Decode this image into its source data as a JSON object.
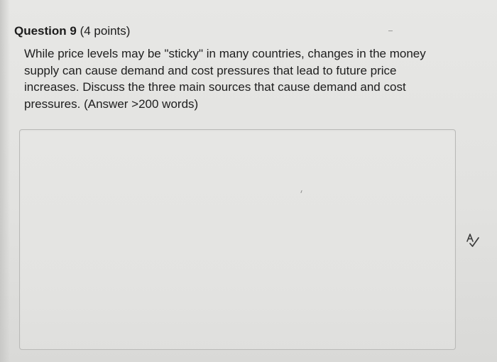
{
  "question": {
    "title": "Question 9",
    "points": " (4 points)",
    "prompt_lines": [
      "While price levels may be \"sticky\" in many countries, changes in the money",
      "supply can cause demand and cost pressures that lead to future price",
      "increases. Discuss the three main sources that cause demand and cost",
      "pressures. (Answer >200 words)"
    ]
  },
  "answer": {
    "value": ""
  },
  "icons": {
    "spellcheck": "spellcheck-icon"
  }
}
